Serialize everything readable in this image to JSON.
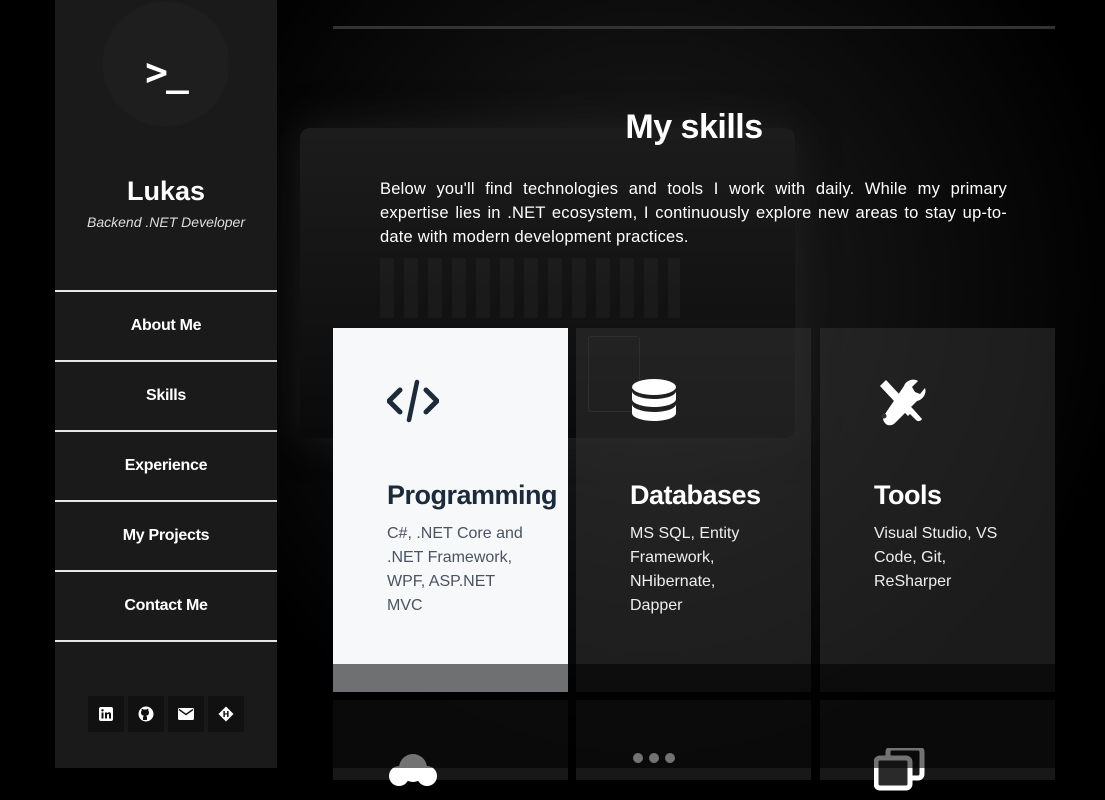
{
  "sidebar": {
    "logo_text": ">_",
    "name": "Lukas",
    "role": "Backend .NET Developer",
    "nav": [
      {
        "label": "About Me"
      },
      {
        "label": "Skills"
      },
      {
        "label": "Experience"
      },
      {
        "label": "My Projects"
      },
      {
        "label": "Contact Me"
      }
    ],
    "socials": [
      {
        "icon": "linkedin-icon"
      },
      {
        "icon": "github-icon"
      },
      {
        "icon": "mail-icon"
      },
      {
        "icon": "hashnode-icon"
      }
    ]
  },
  "main": {
    "title": "My skills",
    "intro": "Below you'll find technologies and tools I work with daily. While my primary expertise lies in .NET ecosystem, I continuously explore new areas to stay up-to-date with modern development practices.",
    "cards": [
      {
        "icon": "code-icon",
        "title": "Programming",
        "desc": "C#, .NET Core and .NET Framework, WPF, ASP.NET MVC"
      },
      {
        "icon": "database-icon",
        "title": "Databases",
        "desc": "MS SQL, Entity Framework, NHibernate, Dapper"
      },
      {
        "icon": "tools-icon",
        "title": "Tools",
        "desc": "Visual Studio, VS Code, Git, ReSharper"
      }
    ],
    "cards_row2": [
      {
        "icon": "cloud-icon"
      },
      {
        "icon": "users-icon"
      },
      {
        "icon": "copy-icon"
      }
    ]
  },
  "colors": {
    "sidebar_bg": "#1a1a1a",
    "card_light_bg": "#f7f8fa",
    "card_light_text": "#1c2a3a",
    "nav_divider": "#e6e6e6"
  }
}
